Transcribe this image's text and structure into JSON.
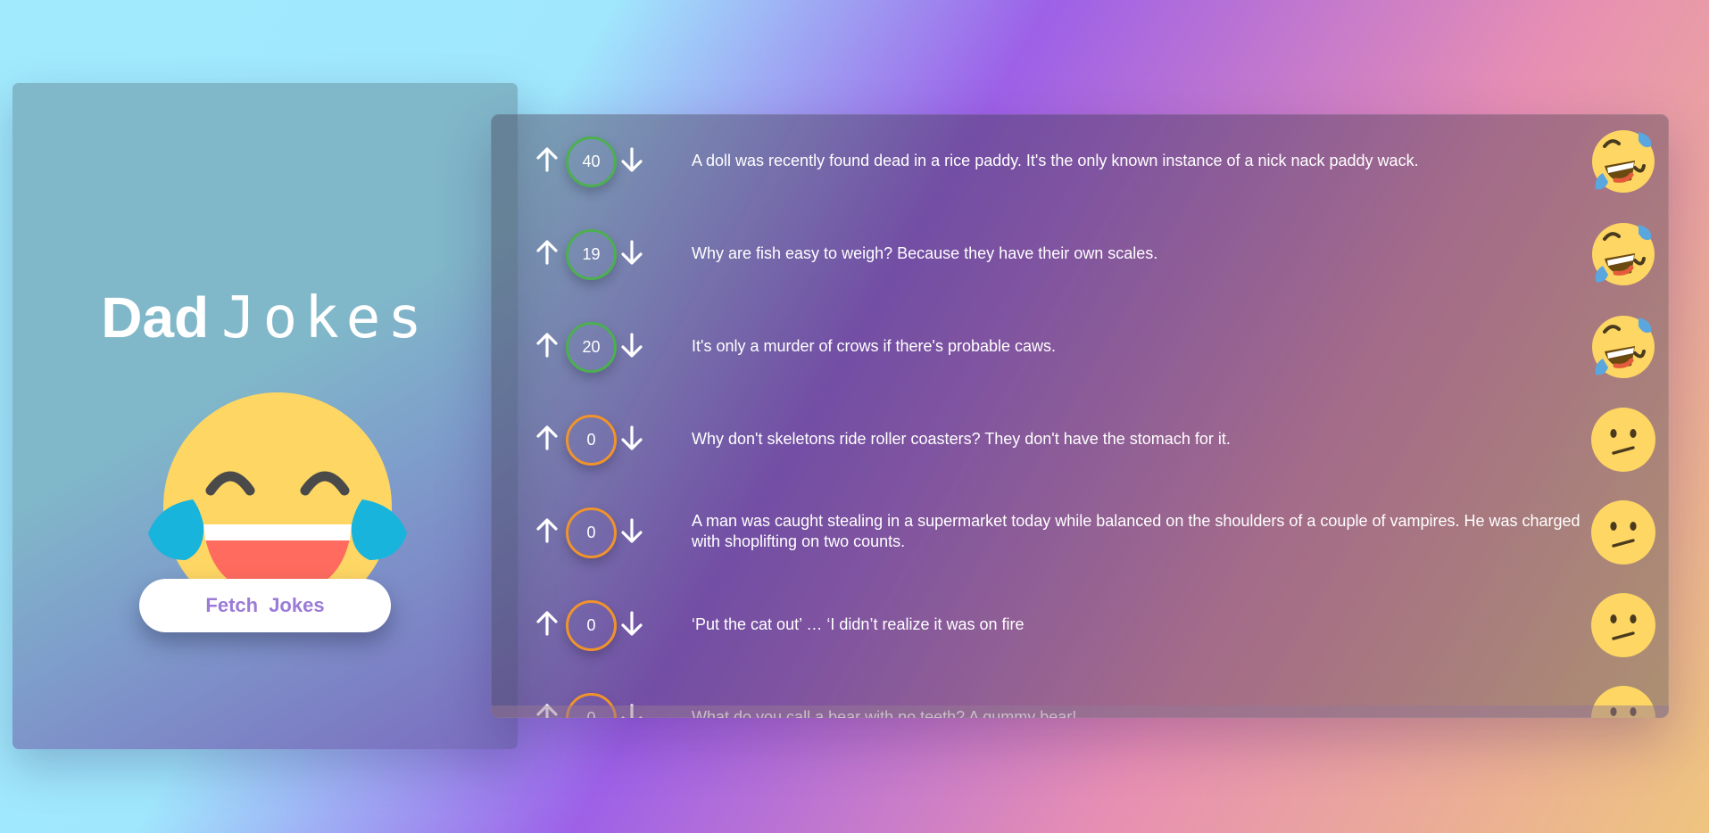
{
  "header": {
    "title_bold": "Dad",
    "title_light": "Jokes"
  },
  "sidebar": {
    "fetch_button_label": "Fetch Jokes",
    "hero_icon": "laughing-tears-emoji-icon"
  },
  "colors": {
    "positive_score_ring": "#4caf50",
    "neutral_score_ring": "#f0932b",
    "button_text": "#9b7bd6"
  },
  "jokes": [
    {
      "votes": "40",
      "text": "A doll was recently found dead in a rice paddy. It's the only known instance of a nick nack paddy wack.",
      "reaction_icon": "rolling-on-floor-laughing-icon"
    },
    {
      "votes": "19",
      "text": "Why are fish easy to weigh? Because they have their own scales.",
      "reaction_icon": "rolling-on-floor-laughing-icon"
    },
    {
      "votes": "20",
      "text": "It's only a murder of crows if there's probable caws.",
      "reaction_icon": "rolling-on-floor-laughing-icon"
    },
    {
      "votes": "0",
      "text": "Why don't skeletons ride roller coasters? They don't have the stomach for it.",
      "reaction_icon": "confused-face-icon"
    },
    {
      "votes": "0",
      "text": "A man was caught stealing in a supermarket today while balanced on the shoulders of a couple of vampires. He was charged with shoplifting on two counts.",
      "reaction_icon": "confused-face-icon"
    },
    {
      "votes": "0",
      "text": "‘Put the cat out’ … ‘I didn’t realize it was on fire",
      "reaction_icon": "confused-face-icon"
    },
    {
      "votes": "0",
      "text": "What do you call a bear with no teeth? A gummy bear!",
      "reaction_icon": "confused-face-icon"
    }
  ]
}
